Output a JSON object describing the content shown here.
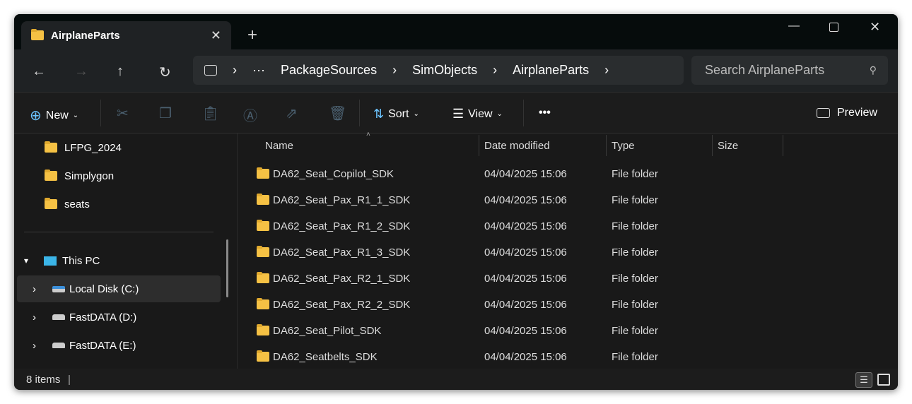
{
  "tab": {
    "title": "AirplaneParts"
  },
  "breadcrumb": [
    "PackageSources",
    "SimObjects",
    "AirplaneParts"
  ],
  "search": {
    "placeholder": "Search AirplaneParts"
  },
  "toolbar": {
    "new": "New",
    "sort": "Sort",
    "view": "View",
    "more": "•••",
    "preview": "Preview"
  },
  "sidebar": {
    "folders": [
      "LFPG_2024",
      "Simplygon",
      "seats"
    ],
    "this_pc": "This PC",
    "drives": [
      "Local Disk (C:)",
      "FastDATA (D:)",
      "FastDATA (E:)"
    ]
  },
  "columns": {
    "name": "Name",
    "date": "Date modified",
    "type": "Type",
    "size": "Size"
  },
  "files": [
    {
      "name": "DA62_Seat_Copilot_SDK",
      "date": "04/04/2025 15:06",
      "type": "File folder"
    },
    {
      "name": "DA62_Seat_Pax_R1_1_SDK",
      "date": "04/04/2025 15:06",
      "type": "File folder"
    },
    {
      "name": "DA62_Seat_Pax_R1_2_SDK",
      "date": "04/04/2025 15:06",
      "type": "File folder"
    },
    {
      "name": "DA62_Seat_Pax_R1_3_SDK",
      "date": "04/04/2025 15:06",
      "type": "File folder"
    },
    {
      "name": "DA62_Seat_Pax_R2_1_SDK",
      "date": "04/04/2025 15:06",
      "type": "File folder"
    },
    {
      "name": "DA62_Seat_Pax_R2_2_SDK",
      "date": "04/04/2025 15:06",
      "type": "File folder"
    },
    {
      "name": "DA62_Seat_Pilot_SDK",
      "date": "04/04/2025 15:06",
      "type": "File folder"
    },
    {
      "name": "DA62_Seatbelts_SDK",
      "date": "04/04/2025 15:06",
      "type": "File folder"
    }
  ],
  "status": {
    "count": "8 items"
  }
}
